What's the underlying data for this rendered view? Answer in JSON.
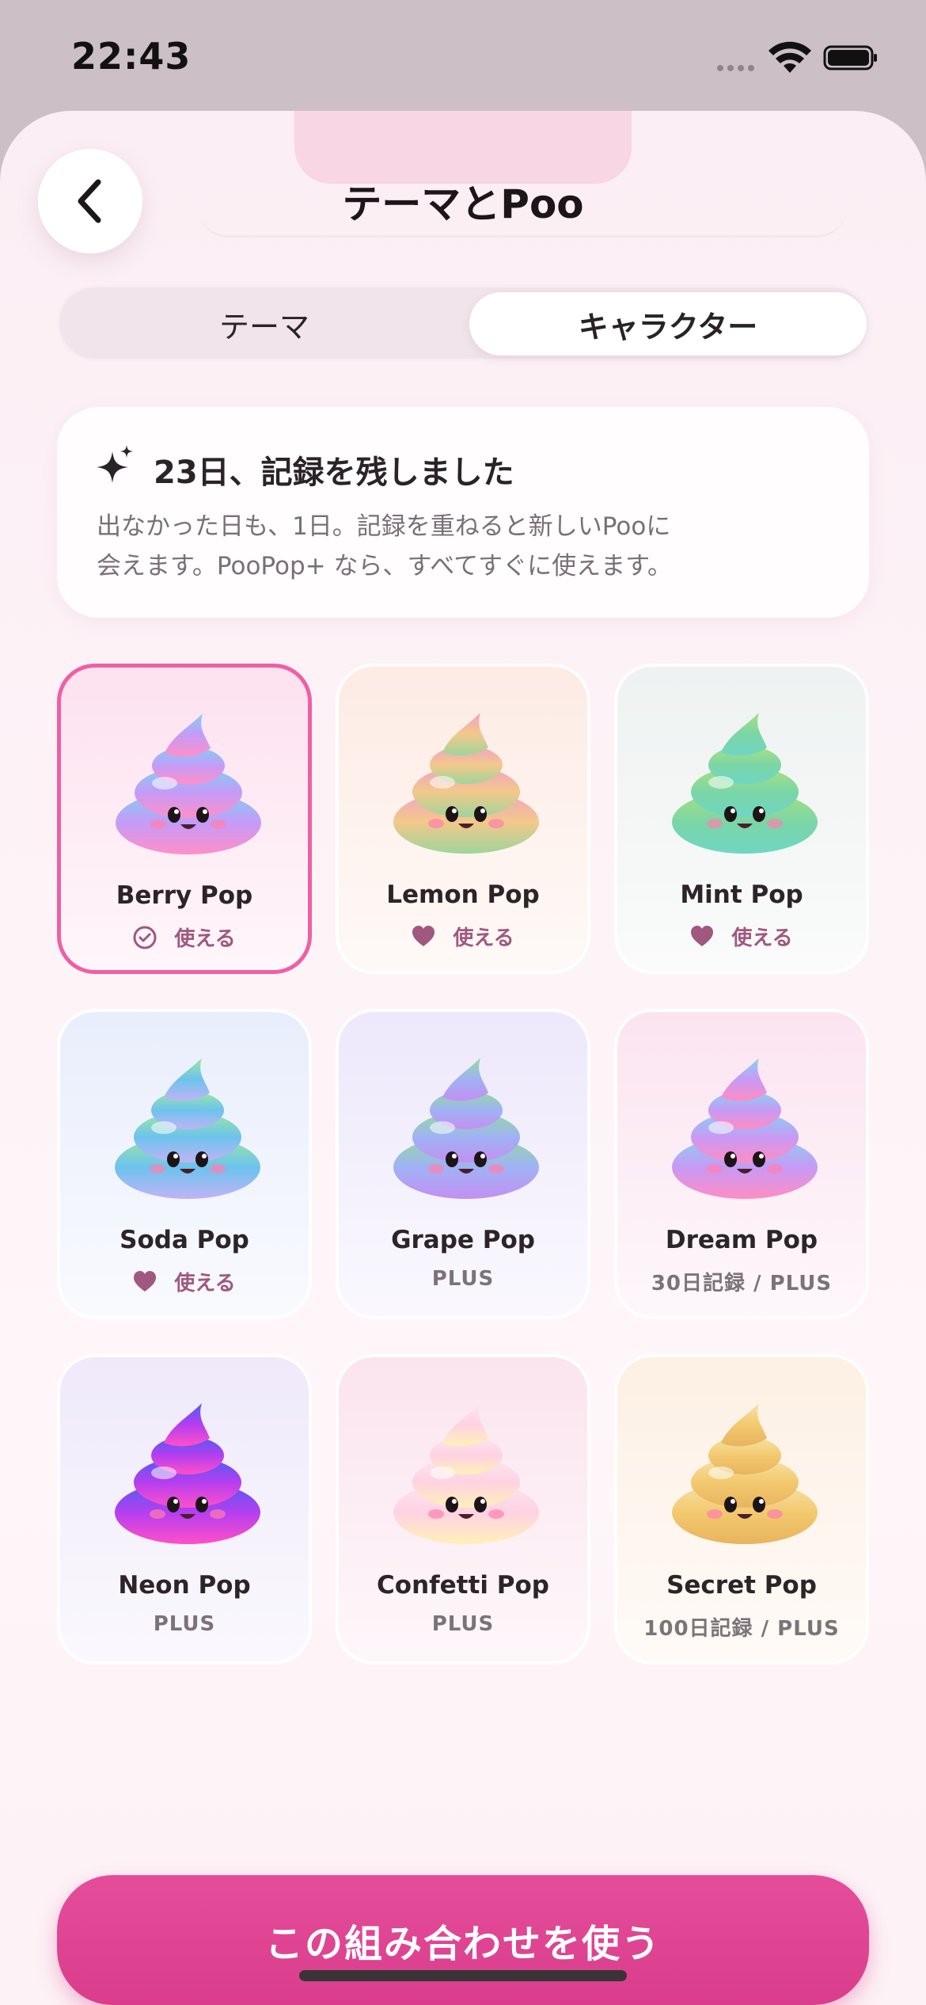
{
  "status_bar": {
    "time": "22:43"
  },
  "header": {
    "title": "テーマとPoo",
    "back_icon": "chevron-left-icon"
  },
  "segmented": {
    "tabs": [
      {
        "label": "テーマ",
        "selected": false
      },
      {
        "label": "キャラクター",
        "selected": true
      }
    ]
  },
  "notice": {
    "icon": "sparkle-icon",
    "title": "23日、記録を残しました",
    "body_line1": "出なかった日も、1日。記録を重ねると新しいPooに",
    "body_line2": "会えます。PooPop+ なら、すべてすぐに使えます。"
  },
  "characters": [
    {
      "name": "Berry Pop",
      "status": "使える",
      "status_icon": "check-circle-icon",
      "selected": true,
      "bg": "#fde1ef",
      "colors": [
        "#7fd0f5",
        "#c59bf7",
        "#ff8fc8"
      ]
    },
    {
      "name": "Lemon Pop",
      "status": "使える",
      "status_icon": "heart-icon",
      "selected": false,
      "bg": "#fdebe4",
      "colors": [
        "#f0a3c7",
        "#f3c88a",
        "#9ed59b"
      ]
    },
    {
      "name": "Mint Pop",
      "status": "使える",
      "status_icon": "heart-icon",
      "selected": false,
      "bg": "#eef2f1",
      "colors": [
        "#a9e07f",
        "#7bd6a6",
        "#6fd6c4"
      ]
    },
    {
      "name": "Soda Pop",
      "status": "使える",
      "status_icon": "heart-icon",
      "selected": false,
      "bg": "#e9eefc",
      "colors": [
        "#9fe7a0",
        "#6cc3ee",
        "#c2b3f5"
      ]
    },
    {
      "name": "Grape Pop",
      "status": "PLUS",
      "status_icon": "",
      "selected": false,
      "bg": "#ede8fb",
      "colors": [
        "#92dba0",
        "#9fb2f5",
        "#c48ff2"
      ]
    },
    {
      "name": "Dream Pop",
      "status": "30日記録 / PLUS",
      "status_icon": "",
      "selected": false,
      "bg": "#fbe4f0",
      "colors": [
        "#85d3f3",
        "#c79af5",
        "#ff8cc4"
      ]
    },
    {
      "name": "Neon Pop",
      "status": "PLUS",
      "status_icon": "",
      "selected": false,
      "bg": "#efe9fa",
      "colors": [
        "#4b5ff0",
        "#b53ef0",
        "#ff4fc9"
      ]
    },
    {
      "name": "Confetti Pop",
      "status": "PLUS",
      "status_icon": "",
      "selected": false,
      "bg": "#fbe4ee",
      "colors": [
        "#fbe7ef",
        "#ffd2e3",
        "#fff0b8"
      ]
    },
    {
      "name": "Secret Pop",
      "status": "100日記録 / PLUS",
      "status_icon": "",
      "selected": false,
      "bg": "#fdf0e4",
      "colors": [
        "#f7e4a8",
        "#f3c96f",
        "#e8b45e"
      ]
    }
  ],
  "cta": {
    "label": "この組み合わせを使う"
  },
  "colors": {
    "accent": "#e04893",
    "selected_border": "#ef5fa4",
    "status_text": "#a0587f"
  }
}
